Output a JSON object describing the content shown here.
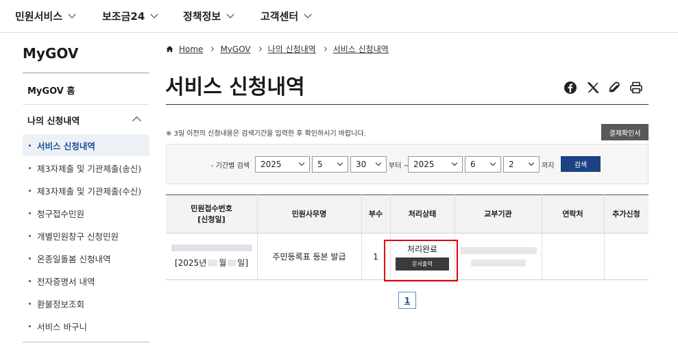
{
  "topnav": [
    {
      "label": "민원서비스"
    },
    {
      "label": "보조금24"
    },
    {
      "label": "정책정보"
    },
    {
      "label": "고객센터"
    }
  ],
  "sidebar": {
    "title": "MyGOV",
    "home": "MyGOV 홈",
    "group": "나의 신청내역",
    "items": [
      {
        "label": "서비스 신청내역"
      },
      {
        "label": "제3자제출 및 기관제출(송신)"
      },
      {
        "label": "제3자제출 및 기관제출(수신)"
      },
      {
        "label": "청구접수민원"
      },
      {
        "label": "개별민원창구 신청민원"
      },
      {
        "label": "온종일돌봄 신청내역"
      },
      {
        "label": "전자증명서 내역"
      },
      {
        "label": "환불정보조회"
      },
      {
        "label": "서비스 바구니"
      }
    ]
  },
  "breadcrumb": [
    "Home",
    "MyGOV",
    "나의 신청내역",
    "서비스 신청내역"
  ],
  "page_title": "서비스 신청내역",
  "share_icons": [
    "facebook-icon",
    "x-icon",
    "paperclip-icon",
    "print-icon"
  ],
  "notice": "※ 3일 이전의 신청내용은 검색기간을 입력한 후 확인하시기 바랍니다.",
  "pay_button": "결제확인서",
  "search": {
    "period_label": "- 기간별 검색",
    "from": {
      "year": "2025",
      "month": "5",
      "day": "30"
    },
    "from_suffix": "부터 ~",
    "to": {
      "year": "2025",
      "month": "6",
      "day": "2"
    },
    "to_suffix": "까지",
    "button": "검색"
  },
  "table": {
    "headers": [
      "민원접수번호",
      "[신청일]",
      "민원사무명",
      "부수",
      "처리상태",
      "교부기관",
      "연락처",
      "추가신청"
    ],
    "row": {
      "date_prefix": "[2025년",
      "date_mid": "월",
      "date_suffix": "일]",
      "service": "주민등록표 등본 발급",
      "copies": "1",
      "status": "처리완료",
      "doc_button": "문서출력"
    }
  },
  "pagination": {
    "current": "1"
  },
  "colors": {
    "primary": "#1d4283",
    "highlight": "#e10000"
  }
}
